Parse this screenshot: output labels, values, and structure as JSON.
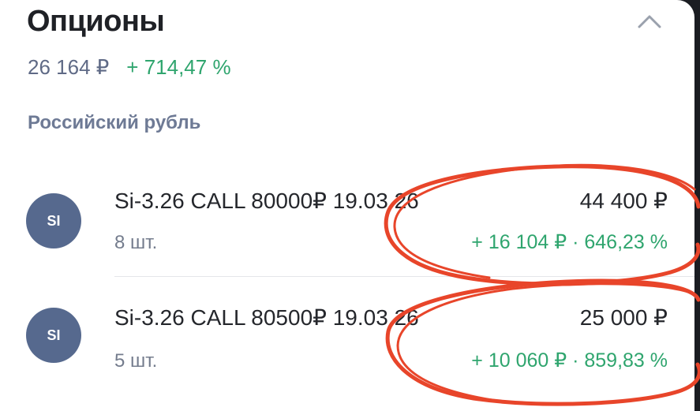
{
  "section": {
    "title": "Опционы",
    "total": "26 164 ₽",
    "total_change": "+ 714,47 %",
    "currency_group": "Российский рубль",
    "collapse_icon": "chevron-up-icon"
  },
  "positions": [
    {
      "ticker_badge": "SI",
      "name": "Si-3.26 CALL 80000₽ 19.03.26",
      "quantity": "8 шт.",
      "value": "44 400 ₽",
      "change": "+ 16 104 ₽ · 646,23 %"
    },
    {
      "ticker_badge": "SI",
      "name": "Si-3.26 CALL 80500₽ 19.03.26",
      "quantity": "5 шт.",
      "value": "25 000 ₽",
      "change": "+ 10 060 ₽ · 859,83 %"
    }
  ],
  "colors": {
    "positive": "#2fa56e",
    "avatar": "#56698e",
    "annotation": "#e8452a"
  }
}
